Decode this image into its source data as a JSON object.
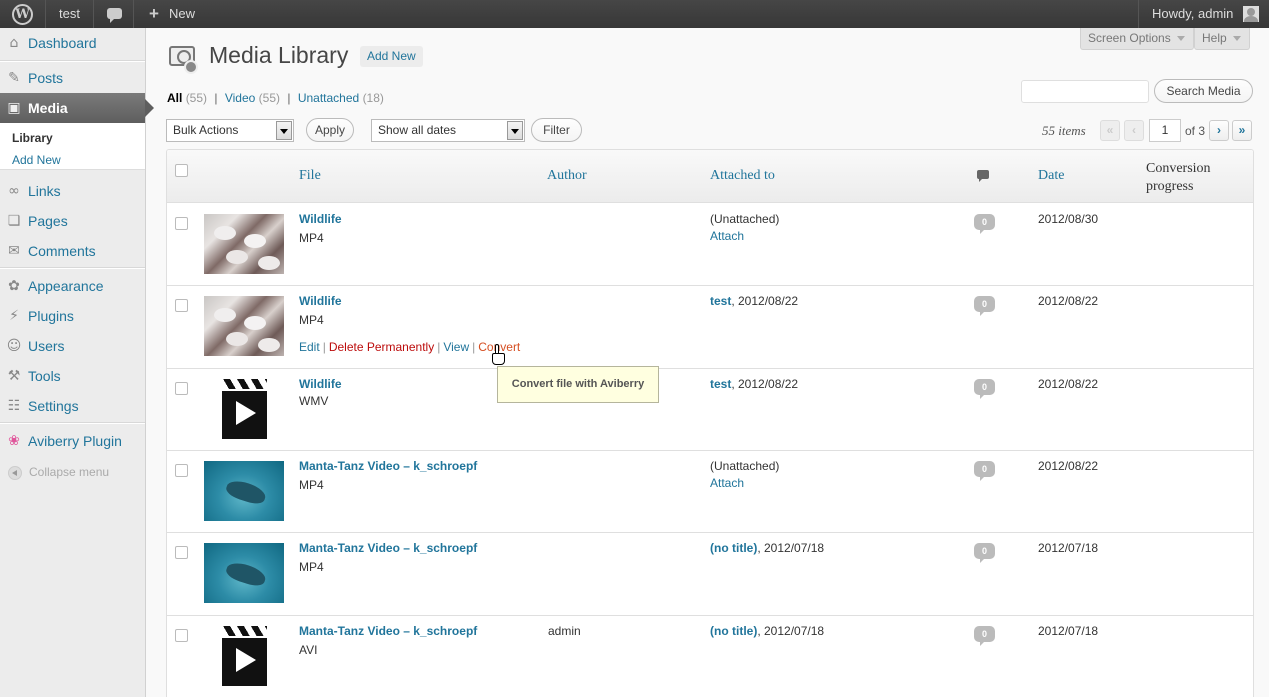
{
  "adminbar": {
    "site_name": "test",
    "new_label": "New",
    "account": "Howdy, admin"
  },
  "sidebar": {
    "items": [
      {
        "label": "Dashboard",
        "icon": "dashboard-icon"
      },
      {
        "label": "Posts",
        "icon": "pushpin-icon"
      },
      {
        "label": "Media",
        "icon": "media-icon"
      },
      {
        "label": "Links",
        "icon": "link-icon"
      },
      {
        "label": "Pages",
        "icon": "pages-icon"
      },
      {
        "label": "Comments",
        "icon": "comments-icon"
      },
      {
        "label": "Appearance",
        "icon": "appearance-icon"
      },
      {
        "label": "Plugins",
        "icon": "plugins-icon"
      },
      {
        "label": "Users",
        "icon": "users-icon"
      },
      {
        "label": "Tools",
        "icon": "tools-icon"
      },
      {
        "label": "Settings",
        "icon": "settings-icon"
      },
      {
        "label": "Aviberry Plugin",
        "icon": "aviberry-icon"
      }
    ],
    "submenu": {
      "library": "Library",
      "add_new": "Add New"
    },
    "collapse": "Collapse menu"
  },
  "screen_options": "Screen Options",
  "help": "Help",
  "page": {
    "title": "Media Library",
    "add_new": "Add New"
  },
  "views": {
    "all": {
      "label": "All",
      "count": "(55)"
    },
    "video": {
      "label": "Video",
      "count": "(55)"
    },
    "unattached": {
      "label": "Unattached",
      "count": "(18)"
    }
  },
  "search": {
    "button": "Search Media",
    "value": ""
  },
  "bulk": {
    "selected": "Bulk Actions",
    "apply": "Apply"
  },
  "dates": {
    "selected": "Show all dates",
    "filter": "Filter"
  },
  "pagination": {
    "displaying": "55 items",
    "first": "«",
    "prev": "‹",
    "current": "1",
    "of": "of 3",
    "next": "›",
    "last": "»"
  },
  "columns": {
    "file": "File",
    "author": "Author",
    "attached": "Attached to",
    "date": "Date",
    "conversion": "Conversion progress"
  },
  "rows": [
    {
      "title": "Wildlife",
      "ext": "MP4",
      "author": "",
      "attached_text": "(Unattached)",
      "attach_link": "Attach",
      "comments": "0",
      "date": "2012/08/30",
      "thumb": "birds"
    },
    {
      "title": "Wildlife",
      "ext": "MP4",
      "author": "",
      "attached_link": "test",
      "attached_date": ", 2012/08/22",
      "comments": "0",
      "date": "2012/08/22",
      "thumb": "birds",
      "actions": {
        "edit": "Edit",
        "delete": "Delete Permanently",
        "view": "View",
        "convert": "Convert"
      }
    },
    {
      "title": "Wildlife",
      "ext": "WMV",
      "author": "",
      "attached_link": "test",
      "attached_date": ", 2012/08/22",
      "comments": "0",
      "date": "2012/08/22",
      "thumb": "clapper"
    },
    {
      "title": "Manta-Tanz Video – k_schroepf",
      "ext": "MP4",
      "author": "",
      "attached_text": "(Unattached)",
      "attach_link": "Attach",
      "comments": "0",
      "date": "2012/08/22",
      "thumb": "manta"
    },
    {
      "title": "Manta-Tanz Video – k_schroepf",
      "ext": "MP4",
      "author": "",
      "attached_link": "(no title)",
      "attached_date": ", 2012/07/18",
      "comments": "0",
      "date": "2012/07/18",
      "thumb": "manta"
    },
    {
      "title": "Manta-Tanz Video – k_schroepf",
      "ext": "AVI",
      "author": "admin",
      "attached_link": "(no title)",
      "attached_date": ", 2012/07/18",
      "comments": "0",
      "date": "2012/07/18",
      "thumb": "clapper"
    }
  ],
  "tooltip": "Convert file with Aviberry",
  "separator": "|"
}
